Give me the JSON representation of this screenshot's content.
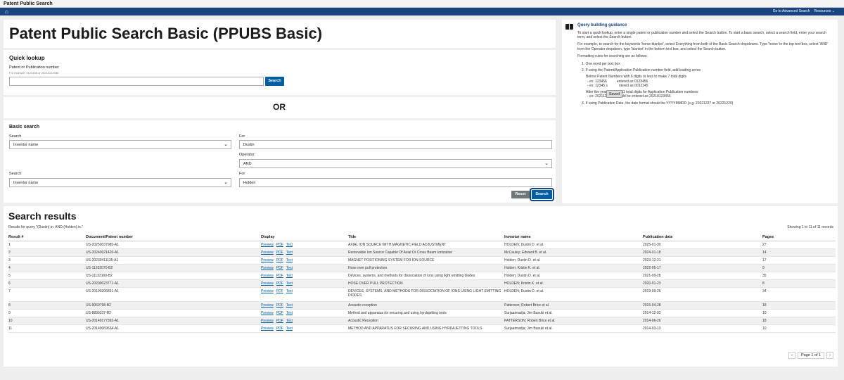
{
  "window": {
    "title": "Patent Public Search"
  },
  "nav": {
    "advanced_link": "Go to Advanced Search",
    "resources": "Resources",
    "resources_caret": "⌄"
  },
  "page": {
    "title": "Patent Public Search Basic (PPUBS Basic)",
    "or_divider": "OR"
  },
  "quick_lookup": {
    "heading": "Quick lookup",
    "field_label": "Patent or Publication number",
    "hint": "For example: 0123456 or 20210123456",
    "value": "",
    "search_label": "Search"
  },
  "basic_search": {
    "heading": "Basic search",
    "search_label_1": "Search",
    "field_1": "Inventor name",
    "for_label_1": "For",
    "term_1": "Dustin",
    "operator_label": "Operator",
    "operator": "AND",
    "search_label_2": "Search",
    "field_2": "Inventor name",
    "for_label_2": "For",
    "term_2": "Holden",
    "reset_label": "Reset",
    "search_label": "Search"
  },
  "guidance": {
    "heading": "Query building guidance",
    "p1": "To start a quick lookup, enter a single patent or publication number and select the Search button. To start a basic search, select a search field, enter your search term, and select the Search button.",
    "p2": "For example, to search for the keywords 'horse blanket', select Everything from both of the Basic Search dropdowns. Type 'horse' in the top text box, select 'AND' from the Operator dropdown, type 'blanket' in the bottom text box, and select the Search button.",
    "p3": "Formatting rules for searching are as follows:",
    "r1": "1. One word per text box",
    "r2": "2. If using the Patent/Application Publication number field, add leading zeros:",
    "r2a": "Before Patent Numbers with 6 digits or less to make 7 total digits",
    "r2b": "- ex: 123456",
    "r2b2": "entered as 0123456",
    "r2c": "- ex: 12345 s",
    "r2c2": "ntered as 0012345",
    "r2d": "After the year to make 11 total digits for Application Publication numbers:",
    "r2e": "- ex: 2021123456 should be entered as 20210123456",
    "r3": "3. If using Publication Date, the date format should be YYYYMMDD (e.g. 20221227 or 20221229)",
    "tooltip": "Saved"
  },
  "results": {
    "heading": "Search results",
    "query_text": "Results for query \"(Dustin).in. AND (Holden).in.\"",
    "showing": "Showing 1 to 11 of 11 records",
    "columns": [
      "Result #",
      "Document/Patent number",
      "Display",
      "Title",
      "Inventor name",
      "Publication date",
      "Pages"
    ],
    "display_links": [
      "Preview",
      "PDF",
      "Text"
    ],
    "rows": [
      {
        "n": "1",
        "doc": "US-20250037985-A1",
        "title": "AXIAL ION SOURCE WITH MAGNETIC FIELD ADJUSTMENT",
        "inventor": "HOLDEN; Dustin D. et al.",
        "date": "2025-01-30",
        "pages": "27"
      },
      {
        "n": "2",
        "doc": "US-20240021426-A1",
        "title": "Removable Ion Source Capable Of Axial Or Cross Beam Ionization",
        "inventor": "McCauley; Edward B. et al.",
        "date": "2024-01-18",
        "pages": "14"
      },
      {
        "n": "3",
        "doc": "US-20230411135-A1",
        "title": "MAGNET POSITIONING SYSTEM FOR ION SOURCE",
        "inventor": "Holden; Dustin D. et al.",
        "date": "2023-12-21",
        "pages": "17"
      },
      {
        "n": "4",
        "doc": "US-11332070-B2",
        "title": "Hose over pull protection",
        "inventor": "Holden; Kristin K. et al.",
        "date": "2022-05-17",
        "pages": "9"
      },
      {
        "n": "5",
        "doc": "US-11133160-B2",
        "title": "Devices, systems, and methods for dissociation of ions using light emitting diodes",
        "inventor": "Holden; Dustin D. et al.",
        "date": "2021-09-28",
        "pages": "35"
      },
      {
        "n": "6",
        "doc": "US-20200023771-A1",
        "title": "HOSE OVER PULL PROTECTION",
        "inventor": "HOLDEN; Kristin K. et al.",
        "date": "2020-01-23",
        "pages": "8"
      },
      {
        "n": "7",
        "doc": "US-20190206831-A1",
        "title": "DEVICES, SYSTEMS, AND METHODS FOR DISSOCIATION OF IONS USING LIGHT EMITTING DIODES",
        "inventor": "HOLDEN; Dustin D. et al.",
        "date": "2019-09-26",
        "pages": "34"
      },
      {
        "n": "8",
        "doc": "US-9069798-B2",
        "title": "Acoustic reception",
        "inventor": "Patterson; Robert Brice et al.",
        "date": "2015-04-28",
        "pages": "18"
      },
      {
        "n": "9",
        "doc": "US-8899337-B2",
        "title": "Method and apparatus for securing and using hyrdajetting tools",
        "inventor": "Surjaatmadja; Jim Basuki et al.",
        "date": "2014-12-02",
        "pages": "10"
      },
      {
        "n": "10",
        "doc": "US-20140177392-A1",
        "title": "Acoustic Reception",
        "inventor": "PATTERSON; Robert Brice et al.",
        "date": "2014-06-26",
        "pages": "18"
      },
      {
        "n": "11",
        "doc": "US-20140069634-A1",
        "title": "METHOD AND APPARATUS FOR SECURING AND USING HYRDAJETTING TOOLS",
        "inventor": "Surjaatmadja; Jim Basuki et al.",
        "date": "2014-03-13",
        "pages": "10"
      }
    ],
    "pagination": {
      "prev": "‹",
      "label": "Page 1 of 1",
      "next": "›"
    }
  },
  "colors": {
    "nav": "#1a4480",
    "primary_button": "#005ea2",
    "reset_button": "#71767a"
  }
}
